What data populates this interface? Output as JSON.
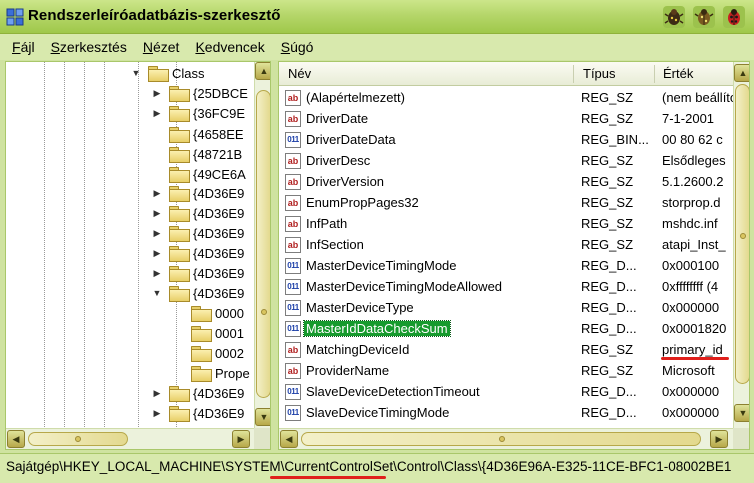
{
  "window": {
    "title": "Rendszerleíróadatbázis-szerkesztő"
  },
  "menu": [
    {
      "label": "Fájl"
    },
    {
      "label": "Szerkesztés"
    },
    {
      "label": "Nézet"
    },
    {
      "label": "Kedvencek"
    },
    {
      "label": "Súgó"
    }
  ],
  "tree": {
    "items": [
      {
        "label": "Class",
        "state": "expanded"
      },
      {
        "label": "{25DBCE",
        "state": "collapsed"
      },
      {
        "label": "{36FC9E",
        "state": "collapsed"
      },
      {
        "label": "{4658EE",
        "state": "none"
      },
      {
        "label": "{48721B",
        "state": "none"
      },
      {
        "label": "{49CE6A",
        "state": "none"
      },
      {
        "label": "{4D36E9",
        "state": "collapsed"
      },
      {
        "label": "{4D36E9",
        "state": "collapsed"
      },
      {
        "label": "{4D36E9",
        "state": "collapsed"
      },
      {
        "label": "{4D36E9",
        "state": "collapsed"
      },
      {
        "label": "{4D36E9",
        "state": "collapsed"
      },
      {
        "label": "{4D36E9",
        "state": "expanded"
      },
      {
        "label": "0000",
        "state": "none"
      },
      {
        "label": "0001",
        "state": "none"
      },
      {
        "label": "0002",
        "state": "none"
      },
      {
        "label": "Prope",
        "state": "none"
      },
      {
        "label": "{4D36E9",
        "state": "collapsed"
      },
      {
        "label": "{4D36E9",
        "state": "collapsed"
      }
    ]
  },
  "list": {
    "headers": {
      "name": "Név",
      "type": "Típus",
      "data": "Érték"
    },
    "rows": [
      {
        "name": "(Alapértelmezett)",
        "type": "REG_SZ",
        "data": "(nem beállított)",
        "icon": "string-value-icon"
      },
      {
        "name": "DriverDate",
        "type": "REG_SZ",
        "data": "7-1-2001",
        "icon": "string-value-icon"
      },
      {
        "name": "DriverDateData",
        "type": "REG_BIN...",
        "data": "00 80 62 c",
        "icon": "binary-value-icon"
      },
      {
        "name": "DriverDesc",
        "type": "REG_SZ",
        "data": "Elsődleges",
        "icon": "string-value-icon"
      },
      {
        "name": "DriverVersion",
        "type": "REG_SZ",
        "data": "5.1.2600.2",
        "icon": "string-value-icon"
      },
      {
        "name": "EnumPropPages32",
        "type": "REG_SZ",
        "data": "storprop.d",
        "icon": "string-value-icon"
      },
      {
        "name": "InfPath",
        "type": "REG_SZ",
        "data": "mshdc.inf",
        "icon": "string-value-icon"
      },
      {
        "name": "InfSection",
        "type": "REG_SZ",
        "data": "atapi_Inst_",
        "icon": "string-value-icon"
      },
      {
        "name": "MasterDeviceTimingMode",
        "type": "REG_D...",
        "data": "0x000100",
        "icon": "binary-value-icon"
      },
      {
        "name": "MasterDeviceTimingModeAllowed",
        "type": "REG_D...",
        "data": "0xffffffff (4",
        "icon": "binary-value-icon"
      },
      {
        "name": "MasterDeviceType",
        "type": "REG_D...",
        "data": "0x000000",
        "icon": "binary-value-icon"
      },
      {
        "name": "MasterIdDataCheckSum",
        "type": "REG_D...",
        "data": "0x0001820",
        "icon": "binary-value-icon",
        "selected": true
      },
      {
        "name": "MatchingDeviceId",
        "type": "REG_SZ",
        "data": "primary_id",
        "icon": "string-value-icon"
      },
      {
        "name": "ProviderName",
        "type": "REG_SZ",
        "data": "Microsoft",
        "icon": "string-value-icon"
      },
      {
        "name": "SlaveDeviceDetectionTimeout",
        "type": "REG_D...",
        "data": "0x000000",
        "icon": "binary-value-icon"
      },
      {
        "name": "SlaveDeviceTimingMode",
        "type": "REG_D...",
        "data": "0x000000",
        "icon": "binary-value-icon"
      }
    ]
  },
  "statusbar": {
    "path": "Sajátgép\\HKEY_LOCAL_MACHINE\\SYSTEM\\CurrentControlSet\\Control\\Class\\{4D36E96A-E325-11CE-BFC1-08002BE1"
  },
  "colors": {
    "chrome": "#cfe3a0",
    "selection": "#179a2e",
    "highlight_underline": "#e0201c"
  }
}
